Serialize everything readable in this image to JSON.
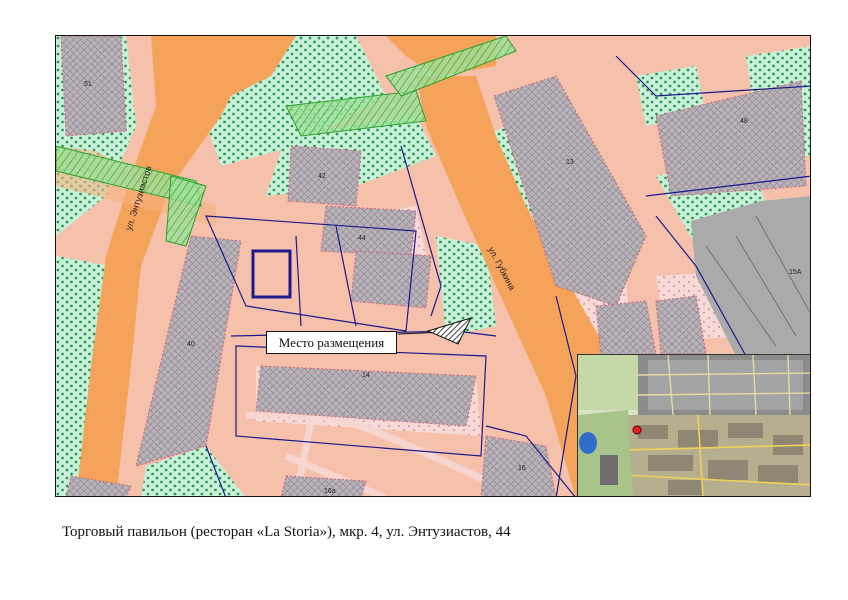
{
  "caption": "Торговый павильон (ресторан «La Storia»), мкр. 4, ул. Энтузиастов, 44",
  "callout_label": "Место размещения",
  "street_labels": {
    "entuziastov": "ул. Энтузиастов",
    "gubkina": "ул. Губкина"
  },
  "building_numbers": {
    "b51": "51",
    "b42": "42",
    "b44": "44",
    "b13": "13",
    "b48": "48",
    "b15a": "15А",
    "b40": "40",
    "b14": "14",
    "b16": "16",
    "b16a": "16а"
  },
  "colors": {
    "background": "#f6c1ab",
    "road": "#f5a35a",
    "green": "#c9f0d8",
    "building": "#b9b3b8",
    "industrial": "#aaaaaa",
    "boundary": "#1a1a8c",
    "hatch_green": "#5ad65a",
    "marker": "#e8201a"
  },
  "icons": {
    "marker": "location-dot-icon",
    "hatched_triangle": "hatched-triangle-icon"
  }
}
